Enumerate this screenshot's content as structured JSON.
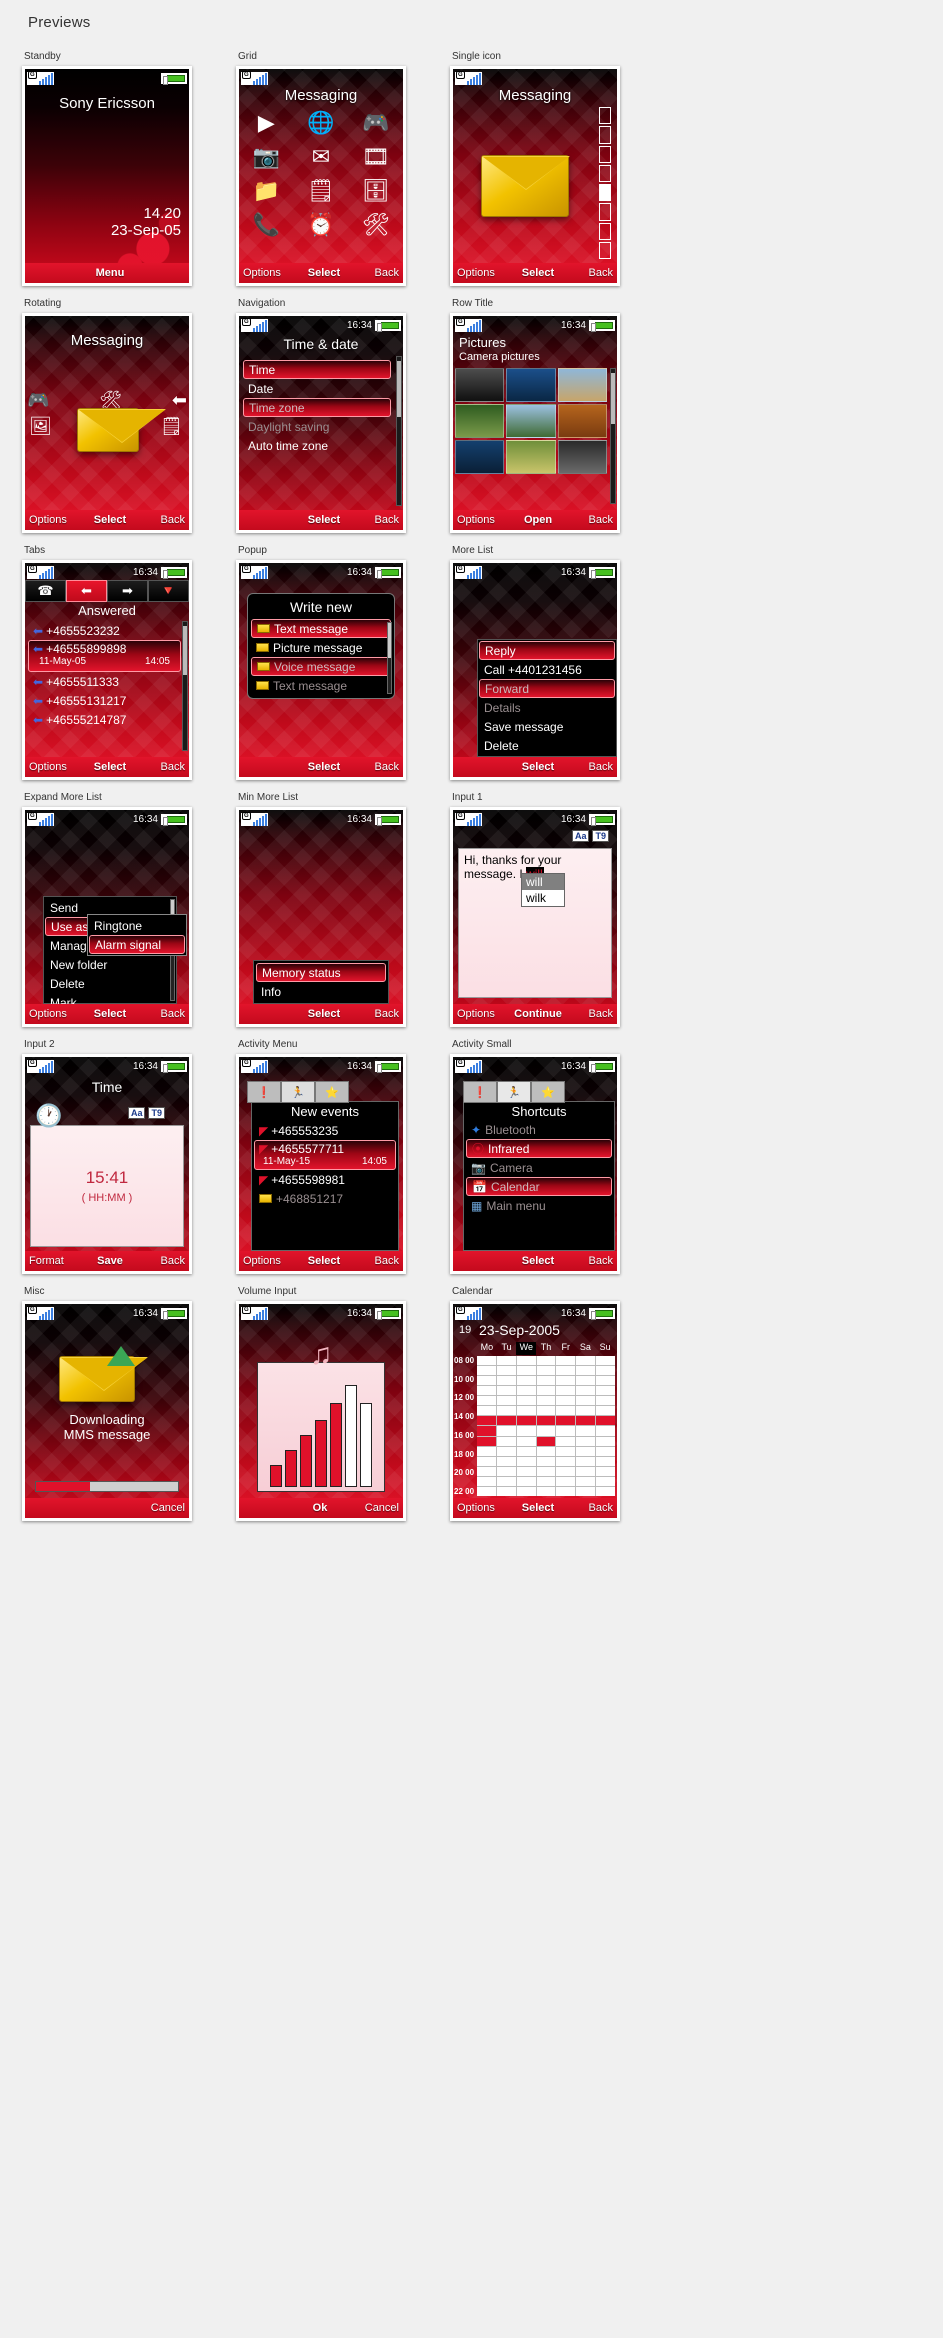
{
  "page": {
    "title": "Previews"
  },
  "status": {
    "clock": "16:34",
    "signal_icon": "signal-bars-icon",
    "battery_icon": "battery-icon",
    "gsm_badge": "G"
  },
  "softkeys": {
    "options": "Options",
    "select": "Select",
    "back": "Back",
    "open": "Open",
    "continue": "Continue",
    "format": "Format",
    "save": "Save",
    "ok": "Ok",
    "cancel": "Cancel",
    "menu": "Menu"
  },
  "previews": [
    {
      "caption": "Standby",
      "brand": "Sony Ericsson",
      "time": "14.20",
      "date": "23-Sep-05",
      "softkey": "Menu"
    },
    {
      "caption": "Grid",
      "title": "Messaging",
      "icons": [
        "play-icon",
        "globe-icon",
        "gamepad-icon",
        "camera-icon",
        "envelope-icon",
        "media-icon",
        "folder-icon",
        "list-icon",
        "calendar-icon",
        "phone-icon",
        "alarm-icon",
        "tools-icon"
      ]
    },
    {
      "caption": "Single icon",
      "title": "Messaging",
      "icon": "envelope-icon"
    },
    {
      "caption": "Rotating",
      "title": "Messaging",
      "icons": [
        "gamepad-icon",
        "tools-icon",
        "arrow-left-icon",
        "photo-icon",
        "envelope-icon",
        "list-icon"
      ]
    },
    {
      "caption": "Navigation",
      "title": "Time & date",
      "items": [
        {
          "label": "Time",
          "state": "selected"
        },
        {
          "label": "Date",
          "state": "normal"
        },
        {
          "label": "Time zone",
          "state": "selected-dim"
        },
        {
          "label": "Daylight saving",
          "state": "dim"
        },
        {
          "label": "Auto time zone",
          "state": "normal"
        }
      ]
    },
    {
      "caption": "Row Title",
      "title": "Pictures",
      "subtitle": "Camera pictures"
    },
    {
      "caption": "Tabs",
      "title": "Answered",
      "tabs": [
        "phone-icon",
        "arrow-left-blue-icon",
        "arrow-right-green-icon",
        "arrow-red-icon"
      ],
      "items": [
        {
          "label": "+4655523232",
          "state": "normal"
        },
        {
          "label": "+46555899898",
          "state": "selected",
          "date": "11-May-05",
          "time": "14:05"
        },
        {
          "label": "+4655511333",
          "state": "normal"
        },
        {
          "label": "+46555131217",
          "state": "normal"
        },
        {
          "label": "+46555214787",
          "state": "normal"
        }
      ]
    },
    {
      "caption": "Popup",
      "title": "Write new",
      "items": [
        {
          "label": "Text message",
          "state": "selected"
        },
        {
          "label": "Picture message",
          "state": "normal"
        },
        {
          "label": "Voice message",
          "state": "selected-dim"
        },
        {
          "label": "Text message",
          "state": "dim"
        }
      ]
    },
    {
      "caption": "More List",
      "items": [
        {
          "label": "Reply",
          "state": "selected"
        },
        {
          "label": "Call +4401231456",
          "state": "normal"
        },
        {
          "label": "Forward",
          "state": "selected-dim"
        },
        {
          "label": "Details",
          "state": "dim"
        },
        {
          "label": "Save message",
          "state": "normal"
        },
        {
          "label": "Delete",
          "state": "normal"
        }
      ]
    },
    {
      "caption": "Expand More List",
      "items": [
        {
          "label": "Send",
          "state": "normal"
        },
        {
          "label": "Use as",
          "state": "selected"
        },
        {
          "label": "Manage file",
          "state": "normal"
        },
        {
          "label": "New folder",
          "state": "normal"
        },
        {
          "label": "Delete",
          "state": "normal"
        },
        {
          "label": "Mark",
          "state": "normal"
        }
      ],
      "submenu": [
        {
          "label": "Ringtone",
          "state": "normal"
        },
        {
          "label": "Alarm signal",
          "state": "selected"
        }
      ]
    },
    {
      "caption": "Min More List",
      "items": [
        {
          "label": "Memory status",
          "state": "selected"
        },
        {
          "label": "Info",
          "state": "normal"
        }
      ]
    },
    {
      "caption": "Input 1",
      "text_before": "Hi, thanks for your message. I ",
      "text_highlight": "will",
      "suggestions": [
        {
          "label": "will",
          "state": "selected"
        },
        {
          "label": "wilk",
          "state": "normal"
        }
      ],
      "mode_badges": [
        "Aa",
        "T9"
      ]
    },
    {
      "caption": "Input 2",
      "title": "Time",
      "value": "15:41",
      "format": "( HH:MM )",
      "mode_badges": [
        "Aa",
        "T9"
      ],
      "icon": "clock-icon"
    },
    {
      "caption": "Activity Menu",
      "title": "New events",
      "tabs": [
        "alert-icon",
        "running-icon",
        "star-icon"
      ],
      "items": [
        {
          "label": "+465553235",
          "state": "normal"
        },
        {
          "label": "+4655577711",
          "state": "selected",
          "date": "11-May-15",
          "time": "14:05"
        },
        {
          "label": "+4655598981",
          "state": "normal"
        },
        {
          "label": "+468851217",
          "state": "dim"
        }
      ]
    },
    {
      "caption": "Activity Small",
      "title": "Shortcuts",
      "tabs": [
        "alert-icon",
        "running-icon",
        "star-icon"
      ],
      "items": [
        {
          "label": "Bluetooth",
          "state": "normal",
          "icon": "bluetooth-icon"
        },
        {
          "label": "Infrared",
          "state": "selected",
          "icon": "infrared-icon"
        },
        {
          "label": "Camera",
          "state": "dim",
          "icon": "camera-icon"
        },
        {
          "label": "Calendar",
          "state": "selected-dim",
          "icon": "calendar-icon"
        },
        {
          "label": "Main menu",
          "state": "normal",
          "icon": "grid-icon"
        }
      ]
    },
    {
      "caption": "Misc",
      "line1": "Downloading",
      "line2": "MMS message",
      "progress_percent": 38,
      "softkey": "Cancel"
    },
    {
      "caption": "Volume Input",
      "icon": "music-note-icon",
      "bars": [
        18,
        30,
        42,
        54,
        68,
        82,
        68
      ],
      "softkeys": [
        "Ok",
        "Cancel"
      ]
    },
    {
      "caption": "Calendar",
      "week": "19",
      "date": "23-Sep-2005",
      "days": [
        "Mo",
        "Tu",
        "We",
        "Th",
        "Fr",
        "Sa",
        "Su"
      ],
      "today_index": 2,
      "times": [
        "08 00",
        "10 00",
        "12 00",
        "14 00",
        "16 00",
        "18 00",
        "20 00",
        "22 00"
      ],
      "busy_cells": [
        [
          6,
          0
        ],
        [
          7,
          0
        ],
        [
          6,
          1
        ],
        [
          6,
          2
        ],
        [
          6,
          3
        ],
        [
          6,
          4
        ],
        [
          6,
          5
        ],
        [
          6,
          6
        ],
        [
          8,
          0
        ],
        [
          8,
          3
        ]
      ]
    }
  ],
  "colors": {
    "accent": "#e0112a",
    "deep_red": "#8c0311",
    "dark": "#000000",
    "battery_green": "#47c020",
    "signal_blue": "#3b7fe0",
    "page_bg": "#f0f0f0"
  }
}
